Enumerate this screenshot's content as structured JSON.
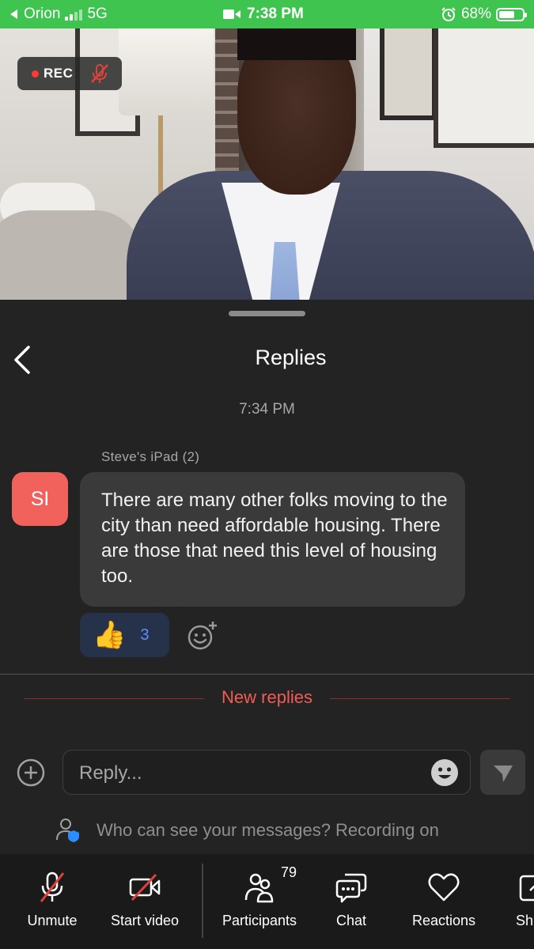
{
  "status_bar": {
    "back_app": "Orion",
    "network": "5G",
    "time": "7:38 PM",
    "battery": "68%",
    "battery_level": 0.68,
    "color": "#3fc44f"
  },
  "video": {
    "rec_label": "REC"
  },
  "replies": {
    "title": "Replies",
    "timestamp": "7:34 PM",
    "sender": "Steve's iPad (2)",
    "avatar_initials": "SI",
    "avatar_color": "#f2625d",
    "message": "There are many other folks moving to the city than need affordable housing. There are those that need this level of housing too.",
    "reaction": {
      "emoji": "👍",
      "count": "3"
    },
    "new_replies_label": "New replies"
  },
  "composer": {
    "placeholder": "Reply...",
    "privacy_text": "Who can see your messages? Recording on"
  },
  "toolbar": {
    "items": [
      {
        "label": "Unmute",
        "icon": "mic-muted-icon"
      },
      {
        "label": "Start video",
        "icon": "video-off-icon"
      },
      {
        "label": "Participants",
        "icon": "participants-icon",
        "count": "79"
      },
      {
        "label": "Chat",
        "icon": "chat-icon"
      },
      {
        "label": "Reactions",
        "icon": "heart-icon"
      },
      {
        "label": "Sh",
        "icon": "share-icon"
      }
    ]
  }
}
